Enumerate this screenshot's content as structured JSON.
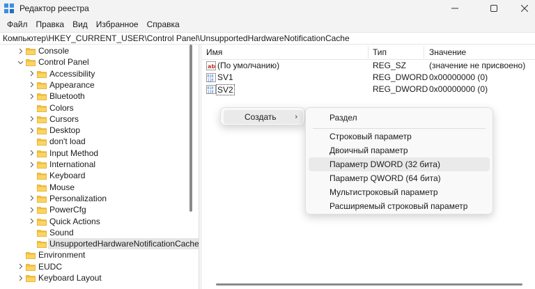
{
  "window": {
    "title": "Редактор реестра",
    "min_icon": "minimize-icon",
    "max_icon": "maximize-icon",
    "close_icon": "close-icon"
  },
  "menu": [
    "Файл",
    "Правка",
    "Вид",
    "Избранное",
    "Справка"
  ],
  "address": "Компьютер\\HKEY_CURRENT_USER\\Control Panel\\UnsupportedHardwareNotificationCache",
  "tree": [
    {
      "label": "Console",
      "expander": "collapsed"
    },
    {
      "label": "Control Panel",
      "expander": "expanded"
    },
    {
      "label": "Accessibility",
      "expander": "collapsed"
    },
    {
      "label": "Appearance",
      "expander": "collapsed"
    },
    {
      "label": "Bluetooth",
      "expander": "collapsed"
    },
    {
      "label": "Colors",
      "expander": "none"
    },
    {
      "label": "Cursors",
      "expander": "collapsed"
    },
    {
      "label": "Desktop",
      "expander": "collapsed"
    },
    {
      "label": "don't load",
      "expander": "none"
    },
    {
      "label": "Input Method",
      "expander": "collapsed"
    },
    {
      "label": "International",
      "expander": "collapsed"
    },
    {
      "label": "Keyboard",
      "expander": "none"
    },
    {
      "label": "Mouse",
      "expander": "none"
    },
    {
      "label": "Personalization",
      "expander": "collapsed"
    },
    {
      "label": "PowerCfg",
      "expander": "collapsed"
    },
    {
      "label": "Quick Actions",
      "expander": "collapsed"
    },
    {
      "label": "Sound",
      "expander": "none"
    },
    {
      "label": "UnsupportedHardwareNotificationCache",
      "expander": "none",
      "selected": true
    },
    {
      "label": "Environment",
      "expander": "none"
    },
    {
      "label": "EUDC",
      "expander": "collapsed"
    },
    {
      "label": "Keyboard Layout",
      "expander": "collapsed"
    }
  ],
  "list": {
    "columns": [
      "Имя",
      "Тип",
      "Значение"
    ],
    "rows": [
      {
        "icon": "string-value-icon",
        "name": "(По умолчанию)",
        "type": "REG_SZ",
        "value": "(значение не присвоено)"
      },
      {
        "icon": "binary-value-icon",
        "name": "SV1",
        "type": "REG_DWORD",
        "value": "0x00000000 (0)"
      },
      {
        "icon": "binary-value-icon",
        "name": "SV2",
        "type": "REG_DWORD",
        "value": "0x00000000 (0)"
      }
    ]
  },
  "context_menu": {
    "create_label": "Создать",
    "submenu": [
      "Раздел",
      "Строковый параметр",
      "Двоичный параметр",
      "Параметр DWORD (32 бита)",
      "Параметр QWORD (64 бита)",
      "Мультистроковый параметр",
      "Расширяемый строковый параметр"
    ],
    "hover_index": 3
  },
  "colors": {
    "folder": "#f5c242",
    "folder_dark": "#e0a820",
    "selected": "#e5e5e5",
    "accent": "#0067c0"
  }
}
